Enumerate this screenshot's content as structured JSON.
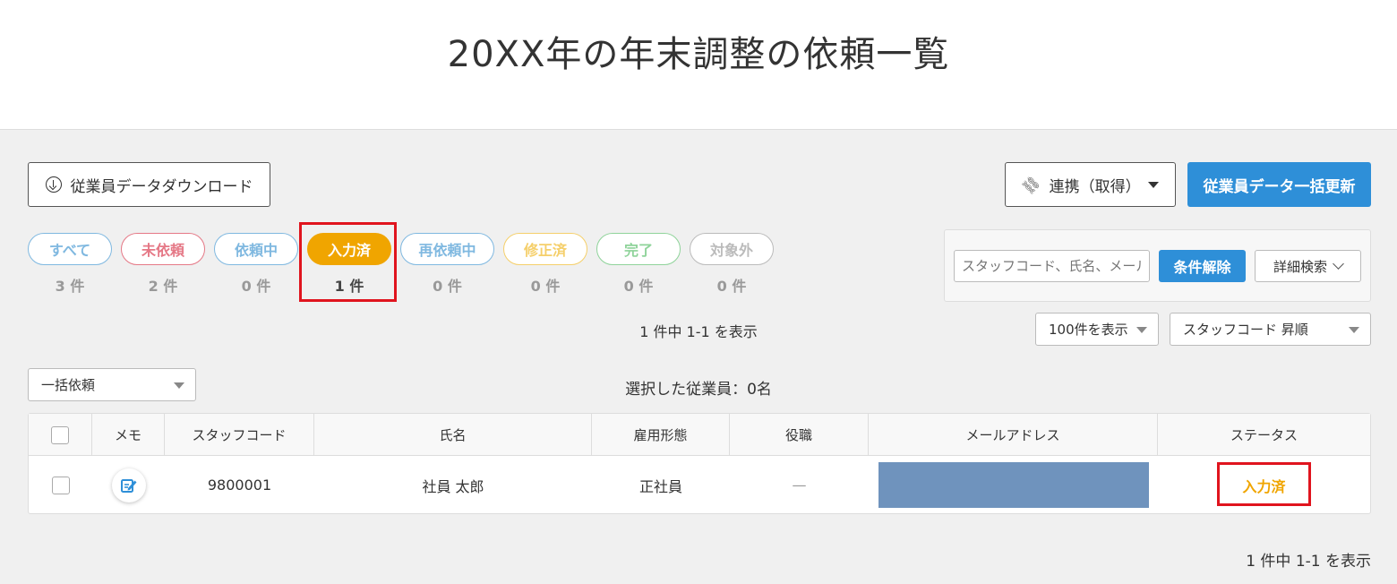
{
  "page": {
    "title": "20XX年の年末調整の依頼一覧"
  },
  "toolbar": {
    "download_label": "従業員データダウンロード",
    "link_label": "連携（取得）",
    "bulk_update_label": "従業員データ一括更新"
  },
  "filters": [
    {
      "label": "すべて",
      "count": "3 件",
      "color": "#7fb8e0",
      "active": false
    },
    {
      "label": "未依頼",
      "count": "2 件",
      "color": "#e57886",
      "active": false
    },
    {
      "label": "依頼中",
      "count": "0 件",
      "color": "#7fb8e0",
      "active": false
    },
    {
      "label": "入力済",
      "count": "1 件",
      "color": "#f0a500",
      "active": true
    },
    {
      "label": "再依頼中",
      "count": "0 件",
      "color": "#7fb8e0",
      "active": false
    },
    {
      "label": "修正済",
      "count": "0 件",
      "color": "#f5cf6a",
      "active": false
    },
    {
      "label": "完了",
      "count": "0 件",
      "color": "#8fd39a",
      "active": false
    },
    {
      "label": "対象外",
      "count": "0 件",
      "color": "#bbbbbb",
      "active": false
    }
  ],
  "search": {
    "placeholder": "スタッフコード、氏名、メールアドレス",
    "clear_label": "条件解除",
    "detail_label": "詳細検索"
  },
  "pagination": {
    "summary_top": "1 件中 1-1 を表示",
    "summary_bottom": "1 件中 1-1 を表示",
    "per_page": "100件を表示",
    "sort": "スタッフコード 昇順"
  },
  "bulk": {
    "action_label": "一括依頼",
    "selected_label": "選択した従業員：0名"
  },
  "table": {
    "headers": [
      "メモ",
      "スタッフコード",
      "氏名",
      "雇用形態",
      "役職",
      "メールアドレス",
      "ステータス"
    ],
    "rows": [
      {
        "staff_code": "9800001",
        "name": "社員 太郎",
        "employment": "正社員",
        "position": "—",
        "status": "入力済"
      }
    ]
  },
  "colors": {
    "primary": "#2e8fd8",
    "status_entered": "#f0a500",
    "highlight": "#e0141e",
    "email_mask": "#6f93bd"
  }
}
